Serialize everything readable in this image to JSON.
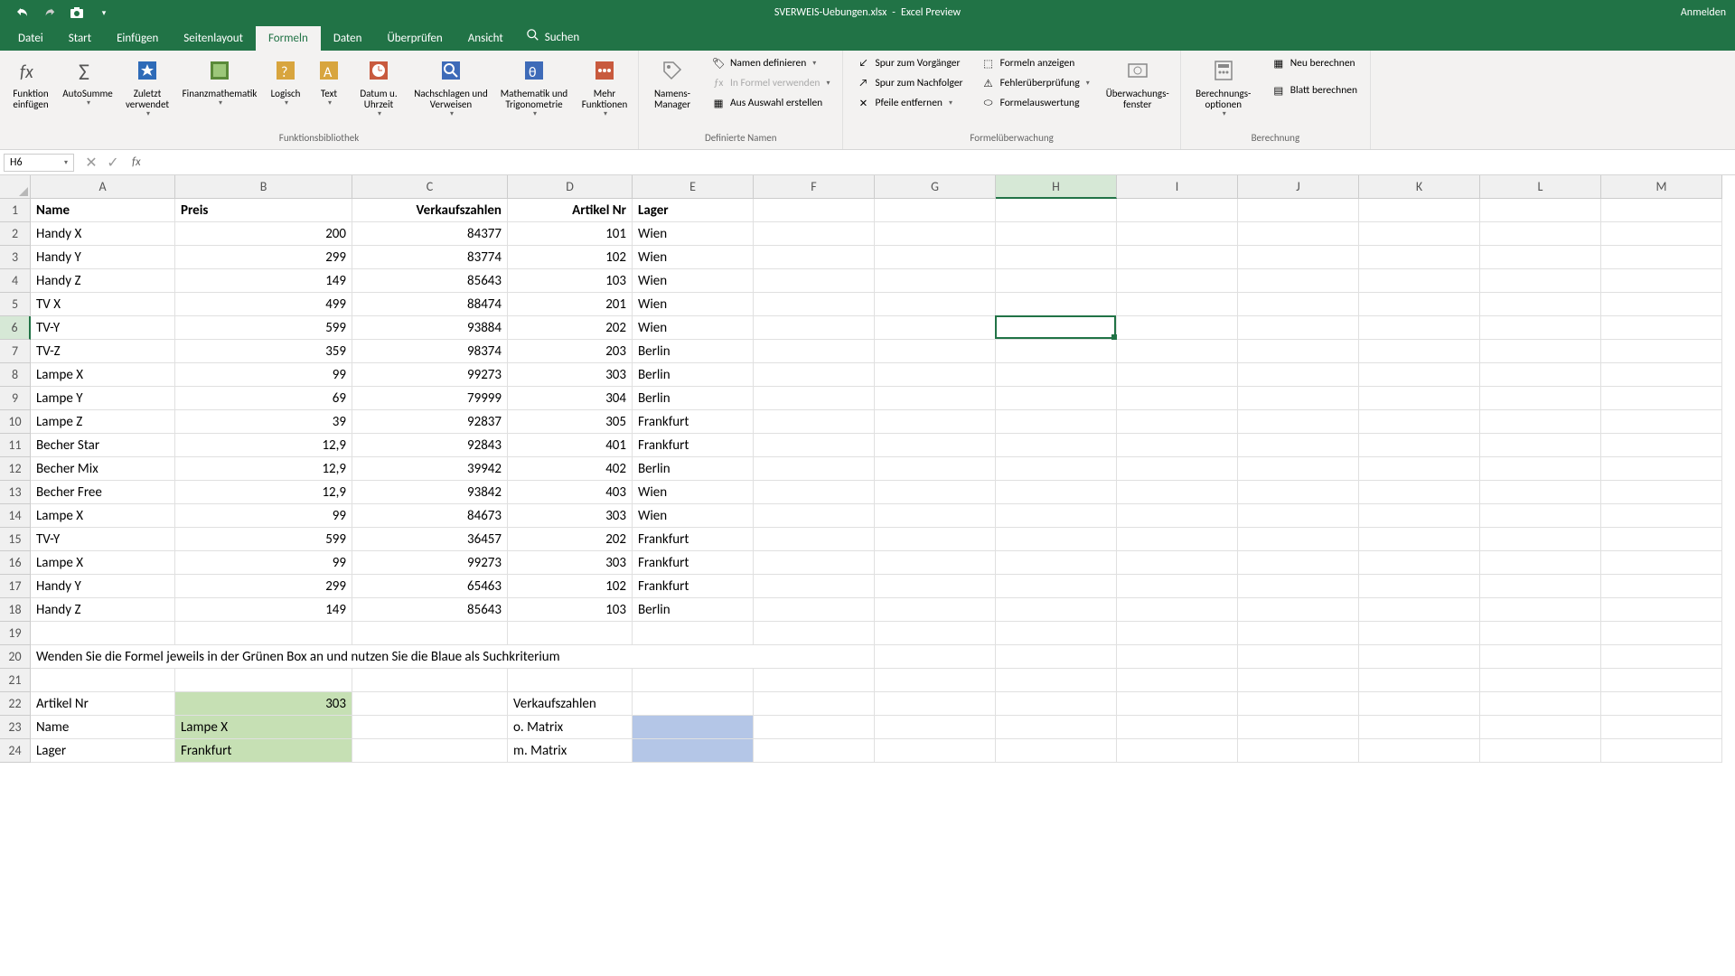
{
  "title": {
    "file": "SVERWEIS-Uebungen.xlsx",
    "mode": "Excel Preview",
    "signin": "Anmelden"
  },
  "tabs": {
    "file": "Datei",
    "home": "Start",
    "insert": "Einfügen",
    "layout": "Seitenlayout",
    "formulas": "Formeln",
    "data": "Daten",
    "review": "Überprüfen",
    "view": "Ansicht",
    "search": "Suchen"
  },
  "ribbon": {
    "fx": "Funktion einfügen",
    "autosum": "AutoSumme",
    "recent": "Zuletzt verwendet",
    "financial": "Finanzmathematik",
    "logical": "Logisch",
    "text": "Text",
    "datetime": "Datum u. Uhrzeit",
    "lookup": "Nachschlagen und Verweisen",
    "math": "Mathematik und Trigonometrie",
    "more": "Mehr Funktionen",
    "grp_lib": "Funktionsbibliothek",
    "name_mgr": "Namens-Manager",
    "def_name": "Namen definieren",
    "use_formula": "In Formel verwenden",
    "create_sel": "Aus Auswahl erstellen",
    "grp_names": "Definierte Namen",
    "trace_prec": "Spur zum Vorgänger",
    "trace_dep": "Spur zum Nachfolger",
    "remove_arrows": "Pfeile entfernen",
    "show_formulas": "Formeln anzeigen",
    "error_check": "Fehlerüberprüfung",
    "eval_formula": "Formelauswertung",
    "watch": "Überwachungs-fenster",
    "grp_audit": "Formelüberwachung",
    "calc_opts": "Berechnungs-optionen",
    "calc_now": "Neu berechnen",
    "calc_sheet": "Blatt berechnen",
    "grp_calc": "Berechnung"
  },
  "namebox": "H6",
  "cols": [
    "A",
    "B",
    "C",
    "D",
    "E",
    "F",
    "G",
    "H",
    "I",
    "J",
    "K",
    "L",
    "M"
  ],
  "headers": {
    "A": "Name",
    "B": "Preis",
    "C": "Verkaufszahlen",
    "D": "Artikel Nr",
    "E": "Lager"
  },
  "rows": [
    {
      "A": "Handy X",
      "B": "200",
      "C": "84377",
      "D": "101",
      "E": "Wien"
    },
    {
      "A": "Handy Y",
      "B": "299",
      "C": "83774",
      "D": "102",
      "E": "Wien"
    },
    {
      "A": "Handy Z",
      "B": "149",
      "C": "85643",
      "D": "103",
      "E": "Wien"
    },
    {
      "A": "TV X",
      "B": "499",
      "C": "88474",
      "D": "201",
      "E": "Wien"
    },
    {
      "A": "TV-Y",
      "B": "599",
      "C": "93884",
      "D": "202",
      "E": "Wien"
    },
    {
      "A": "TV-Z",
      "B": "359",
      "C": "98374",
      "D": "203",
      "E": "Berlin"
    },
    {
      "A": "Lampe X",
      "B": "99",
      "C": "99273",
      "D": "303",
      "E": "Berlin"
    },
    {
      "A": "Lampe Y",
      "B": "69",
      "C": "79999",
      "D": "304",
      "E": "Berlin"
    },
    {
      "A": "Lampe Z",
      "B": "39",
      "C": "92837",
      "D": "305",
      "E": "Frankfurt"
    },
    {
      "A": "Becher Star",
      "B": "12,9",
      "C": "92843",
      "D": "401",
      "E": "Frankfurt"
    },
    {
      "A": "Becher Mix",
      "B": "12,9",
      "C": "39942",
      "D": "402",
      "E": "Berlin"
    },
    {
      "A": "Becher Free",
      "B": "12,9",
      "C": "93842",
      "D": "403",
      "E": "Wien"
    },
    {
      "A": "Lampe X",
      "B": "99",
      "C": "84673",
      "D": "303",
      "E": "Wien"
    },
    {
      "A": "TV-Y",
      "B": "599",
      "C": "36457",
      "D": "202",
      "E": "Frankfurt"
    },
    {
      "A": "Lampe X",
      "B": "99",
      "C": "99273",
      "D": "303",
      "E": "Frankfurt"
    },
    {
      "A": "Handy Y",
      "B": "299",
      "C": "65463",
      "D": "102",
      "E": "Frankfurt"
    },
    {
      "A": "Handy Z",
      "B": "149",
      "C": "85643",
      "D": "103",
      "E": "Berlin"
    }
  ],
  "row20": "Wenden Sie die Formel jeweils in der Grünen Box an und nutzen Sie die Blaue als Suchkriterium",
  "r22": {
    "A": "Artikel Nr",
    "B": "303",
    "D": "Verkaufszahlen"
  },
  "r23": {
    "A": "Name",
    "B": "Lampe X",
    "D": "o. Matrix"
  },
  "r24": {
    "A": "Lager",
    "B": "Frankfurt",
    "D": "m. Matrix"
  }
}
